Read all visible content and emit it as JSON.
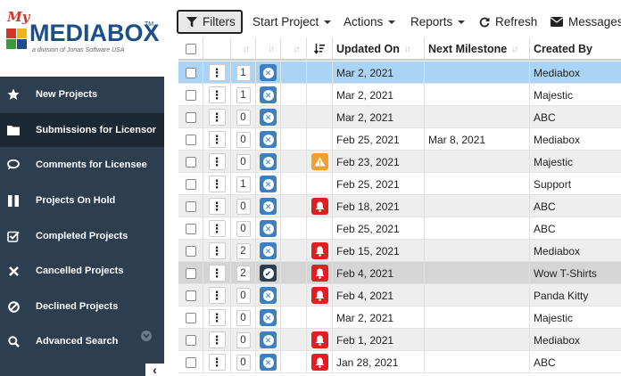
{
  "logo": {
    "my": "My",
    "main": "MEDIABOX",
    "tm": "TM",
    "sub": "a division of Jonas Software USA",
    "colors": [
      "#d4352b",
      "#f2b11d",
      "#3a9a3a",
      "#1b4f8a"
    ]
  },
  "sidebar": {
    "items": [
      {
        "label": "New Projects",
        "icon": "star-icon"
      },
      {
        "label": "Submissions for Licensor",
        "icon": "folder-icon",
        "active": true
      },
      {
        "label": "Comments for Licensee",
        "icon": "comment-icon"
      },
      {
        "label": "Projects On Hold",
        "icon": "pause-icon"
      },
      {
        "label": "Completed Projects",
        "icon": "check-square-icon"
      },
      {
        "label": "Cancelled Projects",
        "icon": "x-icon"
      },
      {
        "label": "Declined Projects",
        "icon": "ban-icon"
      },
      {
        "label": "Advanced Search",
        "icon": "search-icon",
        "chevron": "chevron-down-icon"
      }
    ],
    "collapse": "‹"
  },
  "toolbar": {
    "filters": "Filters",
    "start_project": "Start Project",
    "actions": "Actions",
    "reports": "Reports",
    "refresh": "Refresh",
    "messages": "Messages"
  },
  "table": {
    "headers": {
      "updated_on": "Updated On",
      "next_milestone": "Next Milestone",
      "created_by": "Created By"
    },
    "rows": [
      {
        "count": "1",
        "status": "x",
        "alert": "",
        "updated": "Mar 2, 2021",
        "milestone": "",
        "created": "Mediabox",
        "style": "sel"
      },
      {
        "count": "1",
        "status": "x",
        "alert": "",
        "updated": "Mar 2, 2021",
        "milestone": "",
        "created": "Majestic",
        "style": "even"
      },
      {
        "count": "0",
        "status": "x",
        "alert": "",
        "updated": "Mar 2, 2021",
        "milestone": "",
        "created": "ABC",
        "style": "odd"
      },
      {
        "count": "0",
        "status": "x",
        "alert": "",
        "updated": "Feb 25, 2021",
        "milestone": "Mar 8, 2021",
        "created": "Mediabox",
        "style": "even"
      },
      {
        "count": "0",
        "status": "x",
        "alert": "warning",
        "updated": "Feb 23, 2021",
        "milestone": "",
        "created": "Majestic",
        "style": "odd"
      },
      {
        "count": "1",
        "status": "x",
        "alert": "",
        "updated": "Feb 25, 2021",
        "milestone": "",
        "created": "Support",
        "style": "even"
      },
      {
        "count": "0",
        "status": "x",
        "alert": "bell",
        "updated": "Feb 18, 2021",
        "milestone": "",
        "created": "ABC",
        "style": "odd"
      },
      {
        "count": "0",
        "status": "x",
        "alert": "",
        "updated": "Feb 25, 2021",
        "milestone": "",
        "created": "ABC",
        "style": "even"
      },
      {
        "count": "2",
        "status": "x",
        "alert": "bell",
        "updated": "Feb 15, 2021",
        "milestone": "",
        "created": "Mediabox",
        "style": "odd"
      },
      {
        "count": "2",
        "status": "check",
        "alert": "bell",
        "updated": "Feb 4, 2021",
        "milestone": "",
        "created": "Wow T-Shirts",
        "style": "hl"
      },
      {
        "count": "0",
        "status": "x",
        "alert": "bell",
        "updated": "Feb 4, 2021",
        "milestone": "",
        "created": "Panda Kitty",
        "style": "odd"
      },
      {
        "count": "0",
        "status": "x",
        "alert": "",
        "updated": "Mar 2, 2021",
        "milestone": "",
        "created": "Majestic",
        "style": "even"
      },
      {
        "count": "0",
        "status": "x",
        "alert": "bell",
        "updated": "Feb 1, 2021",
        "milestone": "",
        "created": "Mediabox",
        "style": "odd"
      },
      {
        "count": "0",
        "status": "x",
        "alert": "bell",
        "updated": "Jan 28, 2021",
        "milestone": "",
        "created": "ABC",
        "style": "even"
      }
    ]
  }
}
